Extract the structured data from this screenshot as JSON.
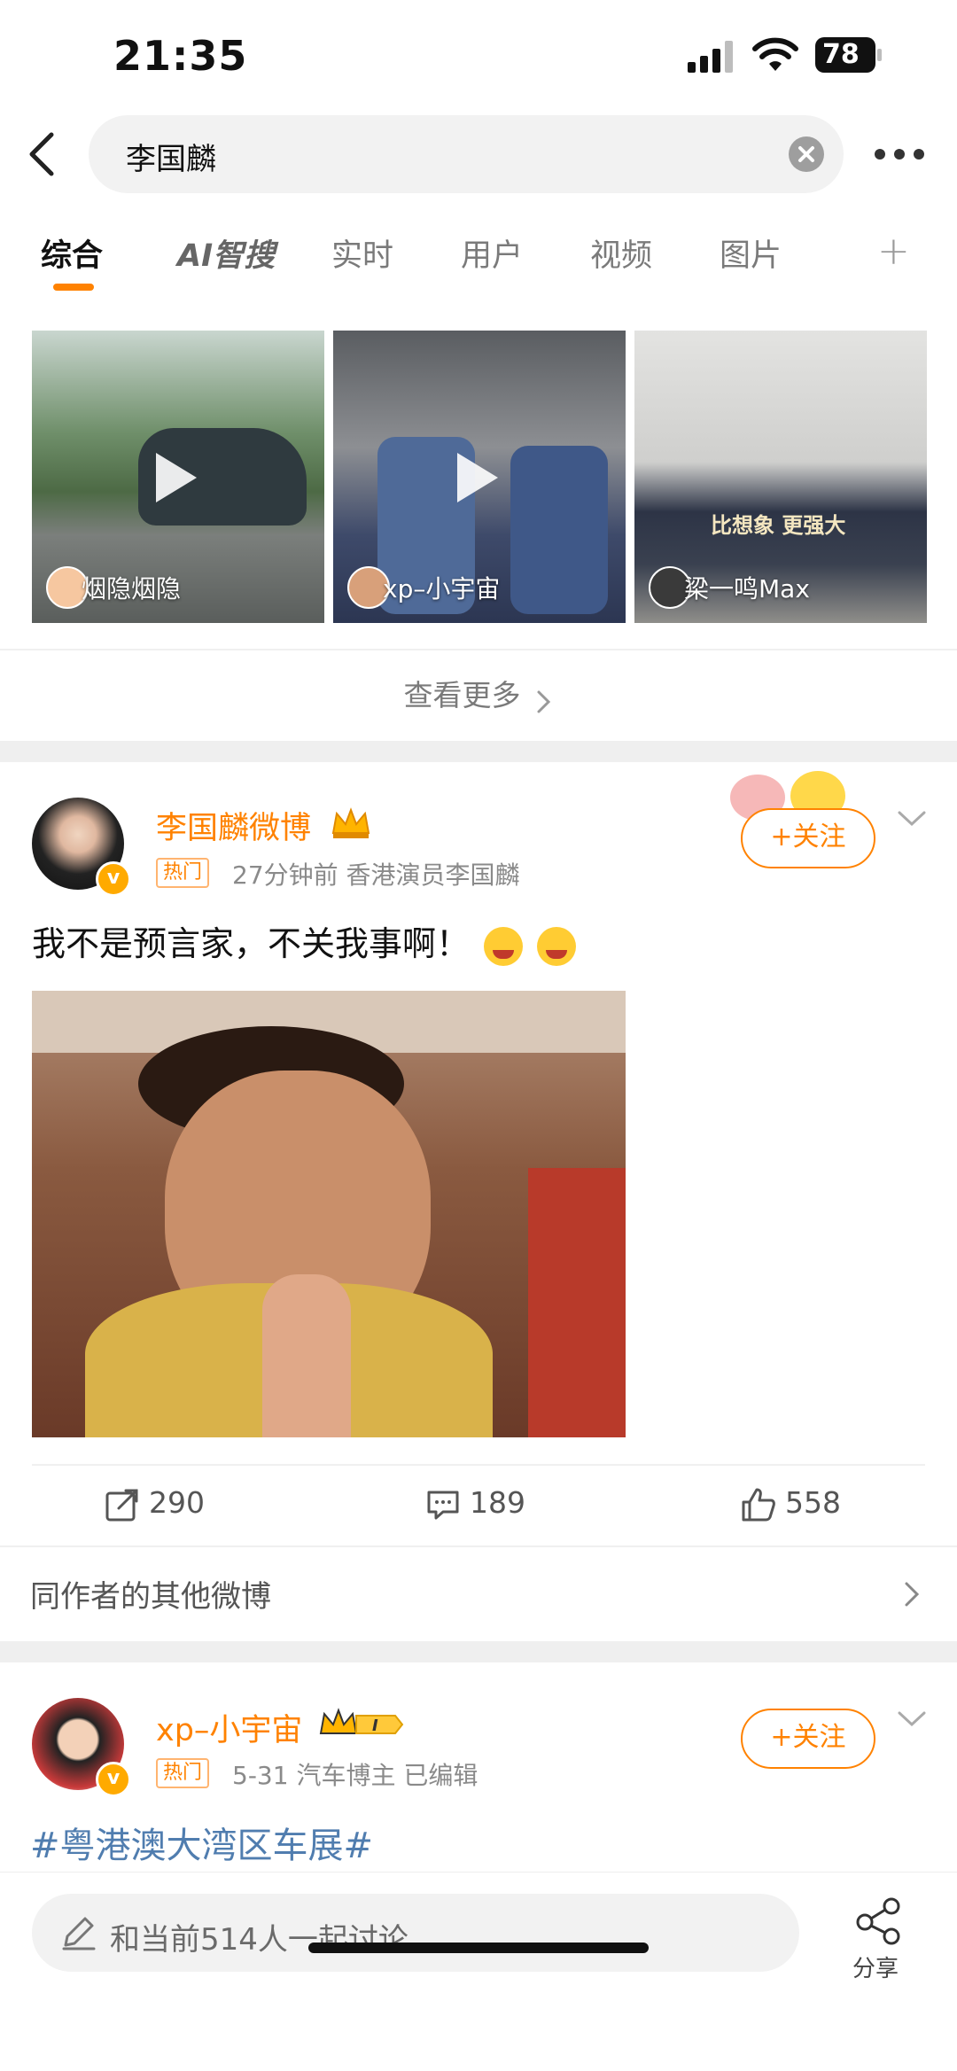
{
  "status": {
    "time": "21:35",
    "battery": "78"
  },
  "search": {
    "query": "李国麟"
  },
  "tabs": [
    {
      "label": "综合"
    },
    {
      "label": "AI智搜"
    },
    {
      "label": "实时"
    },
    {
      "label": "用户"
    },
    {
      "label": "视频"
    },
    {
      "label": "图片"
    }
  ],
  "videos": [
    {
      "author": "烟隐烟隐"
    },
    {
      "author": "xp–小宇宙"
    },
    {
      "author": "梁一鸣Max"
    }
  ],
  "video_overlay_text": {
    "line1": "比想象 更强大"
  },
  "see_more": "查看更多",
  "post1": {
    "username": "李国麟微博",
    "hot_label": "热门",
    "meta": "27分钟前  香港演员李国麟",
    "follow_label": "+关注",
    "text": "我不是预言家，不关我事啊！",
    "reposts": "290",
    "comments": "189",
    "likes": "558"
  },
  "related": "同作者的其他微博",
  "post2": {
    "username": "xp–小宇宙",
    "hot_label": "热门",
    "meta": "5-31  汽车博主  已编辑",
    "follow_label": "+关注",
    "topic": "#粤港澳大湾区车展#"
  },
  "comment_box": {
    "placeholder": "和当前514人一起讨论"
  },
  "share_label": "分享",
  "colors": {
    "accent": "#ff8200",
    "link": "#507daf"
  }
}
